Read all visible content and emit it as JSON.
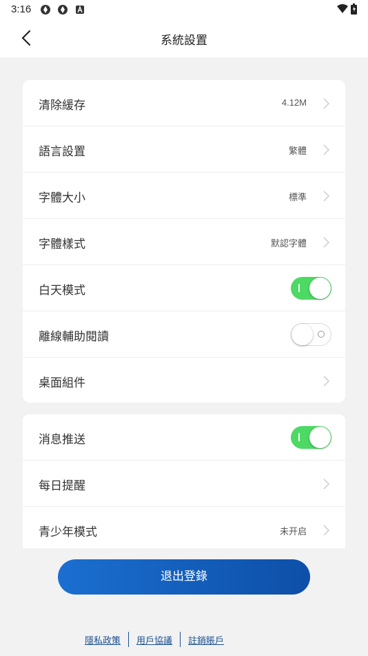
{
  "status_bar": {
    "time": "3:16"
  },
  "header": {
    "title": "系統設置"
  },
  "settings_group1": [
    {
      "label": "清除緩存",
      "value": "4.12M"
    },
    {
      "label": "語言設置",
      "value": "繁體"
    },
    {
      "label": "字體大小",
      "value": "標準"
    },
    {
      "label": "字體樣式",
      "value": "默認字體"
    },
    {
      "label": "白天模式",
      "toggle": true
    },
    {
      "label": "離線輔助閱讀",
      "toggle": false
    },
    {
      "label": "桌面組件",
      "value": ""
    }
  ],
  "settings_group2": [
    {
      "label": "消息推送",
      "toggle": true
    },
    {
      "label": "每日提醒",
      "value": ""
    },
    {
      "label": "青少年模式",
      "value": "未开启"
    }
  ],
  "logout_button": "退出登錄",
  "footer_links": [
    "隱私政策",
    "用戶協議",
    "註銷賬戶"
  ],
  "colors": {
    "toggle_on": "#4cd964",
    "button": "#1460bd",
    "link": "#1a4f8f"
  }
}
